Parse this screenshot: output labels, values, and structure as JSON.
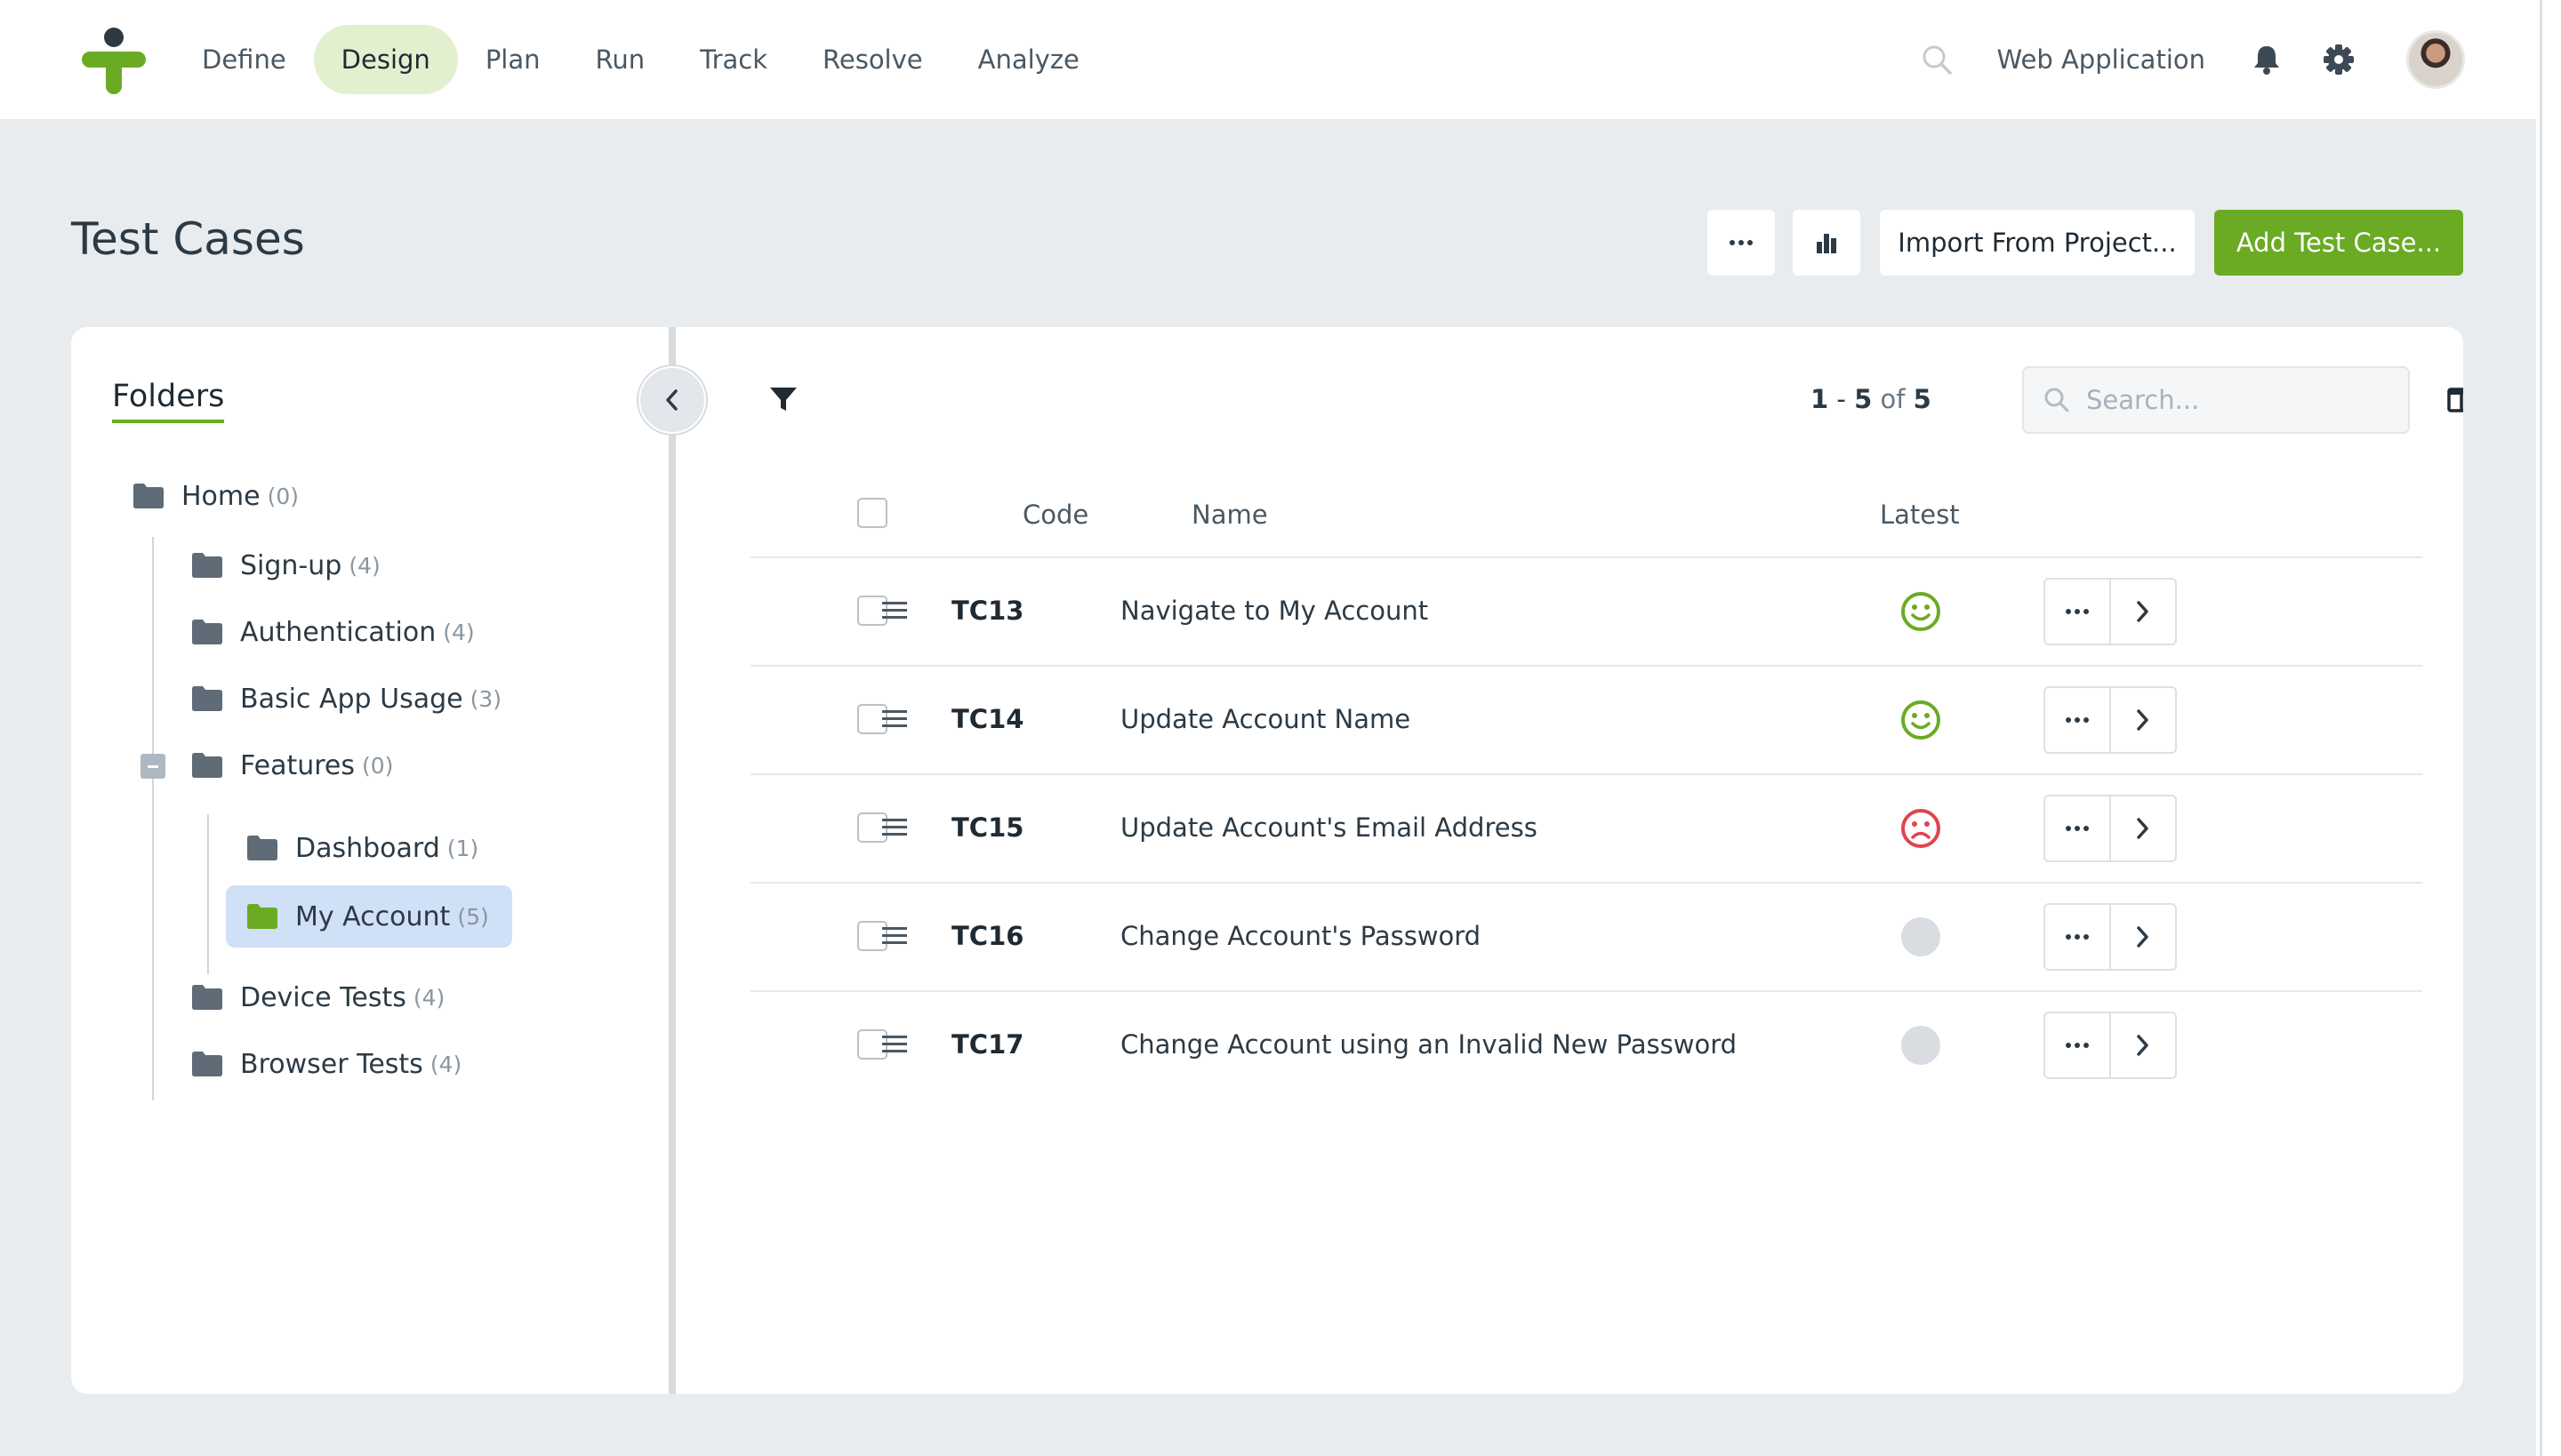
{
  "nav": {
    "items": [
      {
        "label": "Define",
        "active": false
      },
      {
        "label": "Design",
        "active": true
      },
      {
        "label": "Plan",
        "active": false
      },
      {
        "label": "Run",
        "active": false
      },
      {
        "label": "Track",
        "active": false
      },
      {
        "label": "Resolve",
        "active": false
      },
      {
        "label": "Analyze",
        "active": false
      }
    ],
    "project": "Web Application"
  },
  "page": {
    "title": "Test Cases",
    "import_label": "Import From Project...",
    "add_label": "Add Test Case..."
  },
  "folders": {
    "title": "Folders",
    "items": [
      {
        "label": "Home",
        "count": "(0)"
      },
      {
        "label": "Sign-up",
        "count": "(4)"
      },
      {
        "label": "Authentication",
        "count": "(4)"
      },
      {
        "label": "Basic App Usage",
        "count": "(3)"
      },
      {
        "label": "Features",
        "count": "(0)"
      },
      {
        "label": "Dashboard",
        "count": "(1)"
      },
      {
        "label": "My Account",
        "count": "(5)",
        "selected": true
      },
      {
        "label": "Device Tests",
        "count": "(4)"
      },
      {
        "label": "Browser Tests",
        "count": "(4)"
      }
    ]
  },
  "table": {
    "pager": {
      "from": "1",
      "to": "5",
      "of": "of",
      "total": "5"
    },
    "search_placeholder": "Search...",
    "columns": {
      "code": "Code",
      "name": "Name",
      "latest": "Latest"
    },
    "rows": [
      {
        "code": "TC13",
        "name": "Navigate to My Account",
        "latest": "passed"
      },
      {
        "code": "TC14",
        "name": "Update Account Name",
        "latest": "passed"
      },
      {
        "code": "TC15",
        "name": "Update Account's Email Address",
        "latest": "failed"
      },
      {
        "code": "TC16",
        "name": "Change Account's Password",
        "latest": "not-run"
      },
      {
        "code": "TC17",
        "name": "Change Account using an Invalid New Password",
        "latest": "not-run"
      }
    ]
  },
  "colors": {
    "accent": "#6aab23",
    "passed": "#6aab23",
    "failed": "#e0444f",
    "not_run": "#d9dde1",
    "folder": "#5f6b76",
    "folder_selected": "#6aab23"
  }
}
